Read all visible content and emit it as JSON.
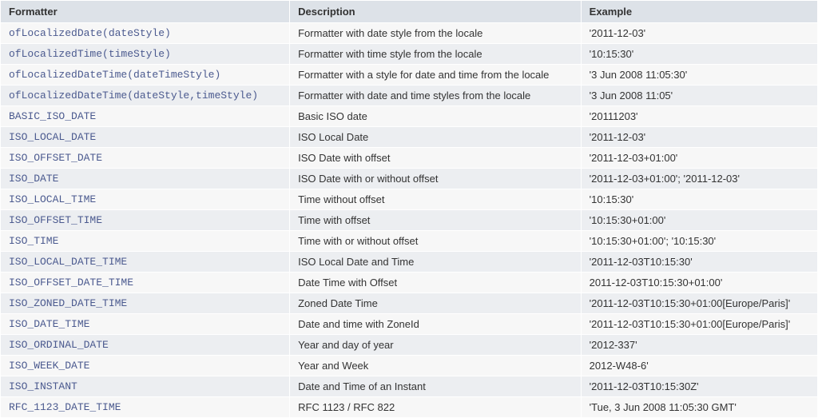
{
  "table": {
    "headers": {
      "formatter": "Formatter",
      "description": "Description",
      "example": "Example"
    },
    "rows": [
      {
        "formatter": "ofLocalizedDate(dateStyle)",
        "description": "Formatter with date style from the locale",
        "example": "'2011-12-03'"
      },
      {
        "formatter": "ofLocalizedTime(timeStyle)",
        "description": "Formatter with time style from the locale",
        "example": "'10:15:30'"
      },
      {
        "formatter": "ofLocalizedDateTime(dateTimeStyle)",
        "description": "Formatter with a style for date and time from the locale",
        "example": "'3 Jun 2008 11:05:30'"
      },
      {
        "formatter": "ofLocalizedDateTime(dateStyle,timeStyle)",
        "description": "Formatter with date and time styles from the locale",
        "example": "'3 Jun 2008 11:05'"
      },
      {
        "formatter": "BASIC_ISO_DATE",
        "description": "Basic ISO date",
        "example": "'20111203'"
      },
      {
        "formatter": "ISO_LOCAL_DATE",
        "description": "ISO Local Date",
        "example": "'2011-12-03'"
      },
      {
        "formatter": "ISO_OFFSET_DATE",
        "description": "ISO Date with offset",
        "example": "'2011-12-03+01:00'"
      },
      {
        "formatter": "ISO_DATE",
        "description": "ISO Date with or without offset",
        "example": "'2011-12-03+01:00'; '2011-12-03'"
      },
      {
        "formatter": "ISO_LOCAL_TIME",
        "description": "Time without offset",
        "example": "'10:15:30'"
      },
      {
        "formatter": "ISO_OFFSET_TIME",
        "description": "Time with offset",
        "example": "'10:15:30+01:00'"
      },
      {
        "formatter": "ISO_TIME",
        "description": "Time with or without offset",
        "example": "'10:15:30+01:00'; '10:15:30'"
      },
      {
        "formatter": "ISO_LOCAL_DATE_TIME",
        "description": "ISO Local Date and Time",
        "example": "'2011-12-03T10:15:30'"
      },
      {
        "formatter": "ISO_OFFSET_DATE_TIME",
        "description": "Date Time with Offset",
        "example": "2011-12-03T10:15:30+01:00'"
      },
      {
        "formatter": "ISO_ZONED_DATE_TIME",
        "description": "Zoned Date Time",
        "example": "'2011-12-03T10:15:30+01:00[Europe/Paris]'"
      },
      {
        "formatter": "ISO_DATE_TIME",
        "description": "Date and time with ZoneId",
        "example": "'2011-12-03T10:15:30+01:00[Europe/Paris]'"
      },
      {
        "formatter": "ISO_ORDINAL_DATE",
        "description": "Year and day of year",
        "example": "'2012-337'"
      },
      {
        "formatter": "ISO_WEEK_DATE",
        "description": "Year and Week",
        "example": "2012-W48-6'"
      },
      {
        "formatter": "ISO_INSTANT",
        "description": "Date and Time of an Instant",
        "example": "'2011-12-03T10:15:30Z'"
      },
      {
        "formatter": "RFC_1123_DATE_TIME",
        "description": "RFC 1123 / RFC 822",
        "example": "'Tue, 3 Jun 2008 11:05:30 GMT'"
      }
    ]
  }
}
